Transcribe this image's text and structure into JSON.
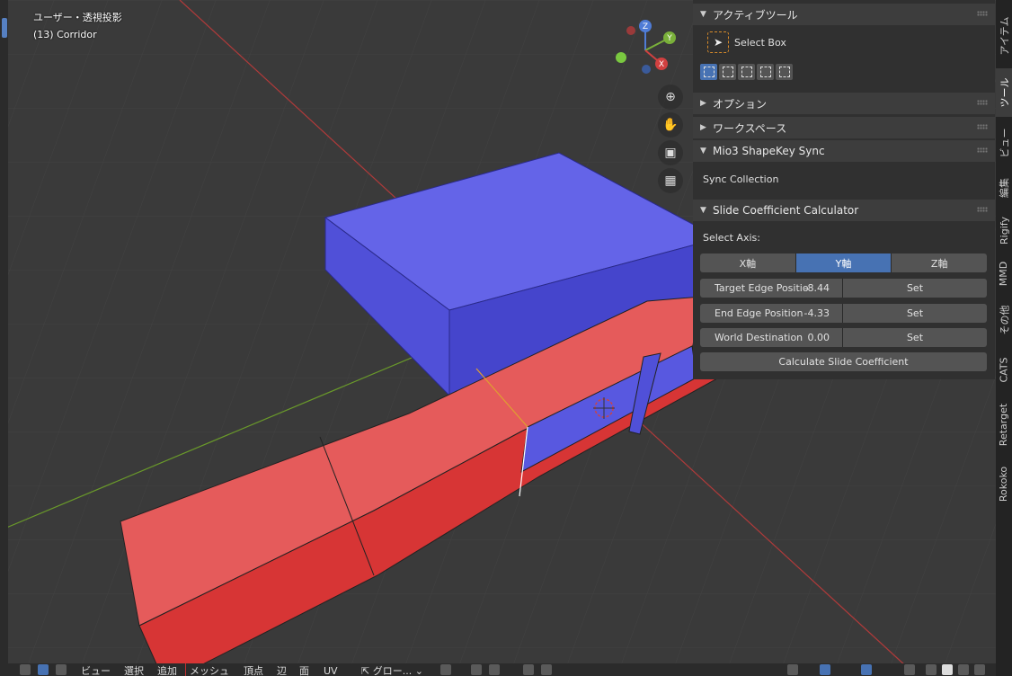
{
  "viewport": {
    "view_name": "ユーザー・透視投影",
    "object_name": "(13) Corridor",
    "gizmo": {
      "z": "Z",
      "y": "Y",
      "x": "X"
    },
    "nav_icons": [
      "zoom-icon",
      "hand-pan-icon",
      "camera-icon",
      "grid-icon"
    ]
  },
  "npanel": {
    "active_tool": {
      "title": "アクティブツール",
      "tool_name": "Select Box"
    },
    "options_title": "オプション",
    "workspace_title": "ワークスペース",
    "shapekey": {
      "title": "Mio3 ShapeKey Sync",
      "sync_collection": "Sync Collection"
    },
    "slide": {
      "title": "Slide Coefficient Calculator",
      "select_axis_label": "Select Axis:",
      "axes": [
        "X軸",
        "Y軸",
        "Z軸"
      ],
      "active_axis": "Y軸",
      "fields": [
        {
          "label": "Target Edge Positio",
          "value": "-8.44",
          "button": "Set"
        },
        {
          "label": "End Edge Position",
          "value": "-4.33",
          "button": "Set"
        },
        {
          "label": "World Destination",
          "value": "0.00",
          "button": "Set"
        }
      ],
      "calc_button": "Calculate Slide Coefficient"
    }
  },
  "right_tabs": [
    "アイテム",
    "ツール",
    "ビュー",
    "編集",
    "Rigify",
    "MMD",
    "その他",
    "CATS",
    "Retarget",
    "Rokoko"
  ],
  "active_right_tab": "ツール",
  "bottom_menu": [
    "ビュー",
    "選択",
    "追加",
    "メッシュ",
    "頂点",
    "辺",
    "面",
    "UV"
  ],
  "transform_orientation": "グロー...",
  "colors": {
    "accent": "#4772b3",
    "red_mesh": "#e55b5b",
    "blue_mesh": "#6464e8",
    "panel_bg": "#303030"
  }
}
